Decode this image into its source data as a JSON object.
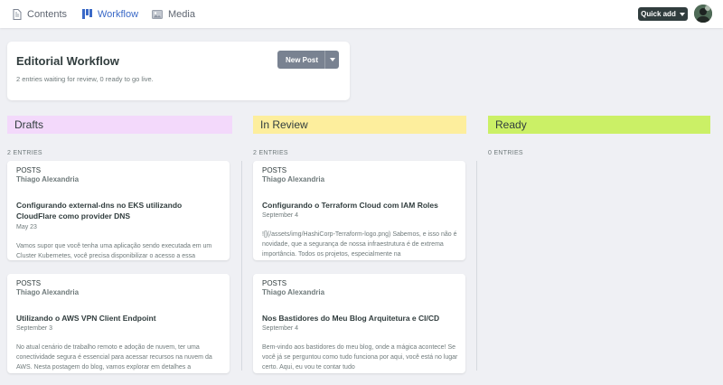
{
  "nav": {
    "items": [
      {
        "label": "Contents",
        "icon": "document-icon"
      },
      {
        "label": "Workflow",
        "icon": "workflow-icon",
        "active": true
      },
      {
        "label": "Media",
        "icon": "image-icon"
      }
    ],
    "quick_add_label": "Quick add"
  },
  "header": {
    "title": "Editorial Workflow",
    "subtitle": "2 entries waiting for review, 0 ready to go live.",
    "new_post_label": "New Post"
  },
  "columns": [
    {
      "label": "Drafts",
      "color": "#f3d9fb",
      "count_label": "2 ENTRIES",
      "cards": [
        {
          "collection": "POSTS",
          "author": "Thiago Alexandria",
          "title": "Configurando external-dns no EKS utilizando CloudFlare como provider DNS",
          "date": "May 23",
          "excerpt": "Vamos supor que você tenha uma aplicação sendo executada em um Cluster Kubernetes, você precisa disponibilizar o acesso a essa"
        },
        {
          "collection": "POSTS",
          "author": "Thiago Alexandria",
          "title": "Utilizando o AWS VPN Client Endpoint",
          "date": "September 3",
          "excerpt": "No atual cenário de trabalho remoto e adoção de nuvem, ter uma conectividade segura é essencial para acessar recursos na nuvem da AWS. Nesta postagem do blog, vamos explorar em detalhes a"
        }
      ]
    },
    {
      "label": "In Review",
      "color": "#fdee9d",
      "count_label": "2 ENTRIES",
      "cards": [
        {
          "collection": "POSTS",
          "author": "Thiago Alexandria",
          "title": "Configurando o Terraform Cloud com IAM Roles",
          "date": "September 4",
          "excerpt": "![](/assets/img/HashiCorp-Terraform-logo.png) Sabemos, e isso não é novidade, que a segurança de nossa infraestrutura é de extrema importância. Todos os projetos, especialmente na"
        },
        {
          "collection": "POSTS",
          "author": "Thiago Alexandria",
          "title": "Nos Bastidores do Meu Blog Arquitetura e CI/CD",
          "date": "September 4",
          "excerpt": "Bem-vindo aos bastidores do meu blog, onde a mágica acontece! Se você já se perguntou como tudo funciona por aqui, você está no lugar certo. Aqui, eu vou te contar tudo"
        }
      ]
    },
    {
      "label": "Ready",
      "color": "#cbf066",
      "count_label": "0 ENTRIES",
      "cards": []
    }
  ]
}
